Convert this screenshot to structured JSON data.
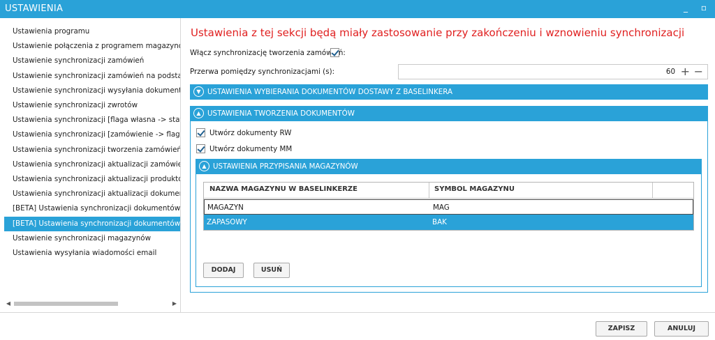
{
  "window": {
    "title": "USTAWIENIA",
    "minimize_glyph": "_",
    "maximize_glyph": "▫"
  },
  "sidebar": {
    "items": [
      {
        "label": "Ustawienia programu"
      },
      {
        "label": "Ustawienie połączenia z programem magazynowym"
      },
      {
        "label": "Ustawienie synchronizacji zamówień"
      },
      {
        "label": "Ustawienie synchronizacji zamówień na podstawie dzi"
      },
      {
        "label": "Ustawienie synchronizacji wysyłania dokumentów"
      },
      {
        "label": "Ustawienie synchronizacji zwrotów"
      },
      {
        "label": "Ustawienia synchronizacji [flaga własna -> status]"
      },
      {
        "label": "Ustawienia synchronizacji [zamówienie -> flaga własn"
      },
      {
        "label": "Ustawienia synchronizacji tworzenia zamówień w Base"
      },
      {
        "label": "Ustawienia synchronizacji aktualizacji zamówień w Bas"
      },
      {
        "label": "Ustawienia synchronizacji aktualizacji produktów w Ba"
      },
      {
        "label": "Ustawienia synchronizacji aktualizacji dokumentów"
      },
      {
        "label": "[BETA] Ustawienia synchronizacji dokumentów dostaw"
      },
      {
        "label": "[BETA] Ustawienia synchronizacji dokumentów magaz"
      },
      {
        "label": "Ustawienie synchronizacji magazynów"
      },
      {
        "label": "Ustawienia wysyłania wiadomości email"
      }
    ],
    "selected_index": 13,
    "scroll_left_glyph": "◀",
    "scroll_right_glyph": "▶"
  },
  "main": {
    "heading": "Ustawienia z tej sekcji będą miały zastosowanie przy zakończeniu i wznowieniu synchronizacji",
    "enable_label": "Włącz synchronizację tworzenia zamówień:",
    "enable_checked": true,
    "interval_label": "Przerwa pomiędzy synchronizacjami (s):",
    "interval_value": "60",
    "plus_glyph": "+",
    "minus_glyph": "−",
    "section1": {
      "title": "USTAWIENIA WYBIERANIA DOKUMENTÓW DOSTAWY Z BASELINKERA",
      "expanded": false,
      "glyph": "▼"
    },
    "section2": {
      "title": "USTAWIENIA TWORZENIA DOKUMENTÓW",
      "expanded": true,
      "glyph": "▲"
    },
    "rw_label": "Utwórz dokumenty RW",
    "rw_checked": true,
    "mm_label": "Utwórz dokumenty MM",
    "mm_checked": true,
    "section3": {
      "title": "USTAWIENIA PRZYPISANIA MAGAZYNÓW",
      "expanded": true,
      "glyph": "▲"
    },
    "table": {
      "columns": [
        "NAZWA MAGAZYNU W BASELINKERZE",
        "SYMBOL MAGAZYNU"
      ],
      "rows": [
        {
          "name": "MAGAZYN",
          "symbol": "MAG"
        },
        {
          "name": "ZAPASOWY",
          "symbol": "BAK"
        }
      ],
      "selected_row": 1
    },
    "add_button": "DODAJ",
    "remove_button": "USUŃ"
  },
  "footer": {
    "save_button": "ZAPISZ",
    "cancel_button": "ANULUJ"
  },
  "colors": {
    "accent": "#2aa2d8",
    "heading": "#e02020"
  }
}
